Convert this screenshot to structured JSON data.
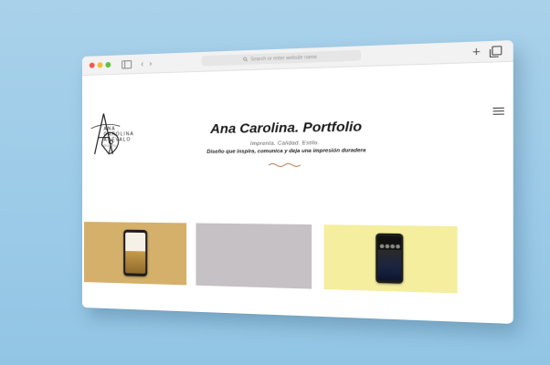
{
  "browser": {
    "url_placeholder": "Search or enter website name",
    "new_tab_label": "+"
  },
  "logo": {
    "line1": "ANA",
    "line2": "CAROLINA",
    "line3": "ARÉVALO",
    "sub": "Diseño"
  },
  "hero": {
    "title": "Ana Carolina. Portfolio",
    "tagline": "Imprenta. Calidad. Estilo.",
    "description": "Diseño que inspira, comunica y deja una impresión duradera"
  },
  "cards": [
    {
      "color": "#d4b06a",
      "content": "phone-mockup"
    },
    {
      "color": "#c5c1c4",
      "content": "empty"
    },
    {
      "color": "#f4ee9e",
      "content": "phone-mockup"
    }
  ],
  "colors": {
    "background": "#a9d1ea",
    "wave_accent": "#b7805a"
  }
}
